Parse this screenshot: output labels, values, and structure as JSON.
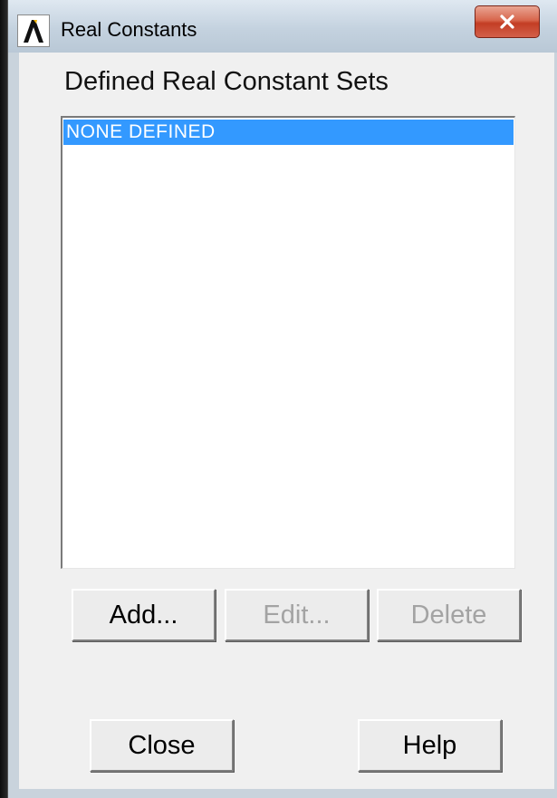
{
  "window": {
    "title": "Real Constants",
    "app_icon": "ansys-logo-icon",
    "close_icon": "close-icon"
  },
  "dialog": {
    "heading": "Defined Real Constant Sets",
    "list": {
      "items": [
        "NONE DEFINED"
      ],
      "selected_index": 0
    },
    "buttons": {
      "add": "Add...",
      "edit": "Edit...",
      "delete": "Delete",
      "close": "Close",
      "help": "Help"
    }
  },
  "colors": {
    "selection": "#3399ff",
    "close_button": "#c94a33",
    "disabled_text": "#a3a3a3"
  }
}
